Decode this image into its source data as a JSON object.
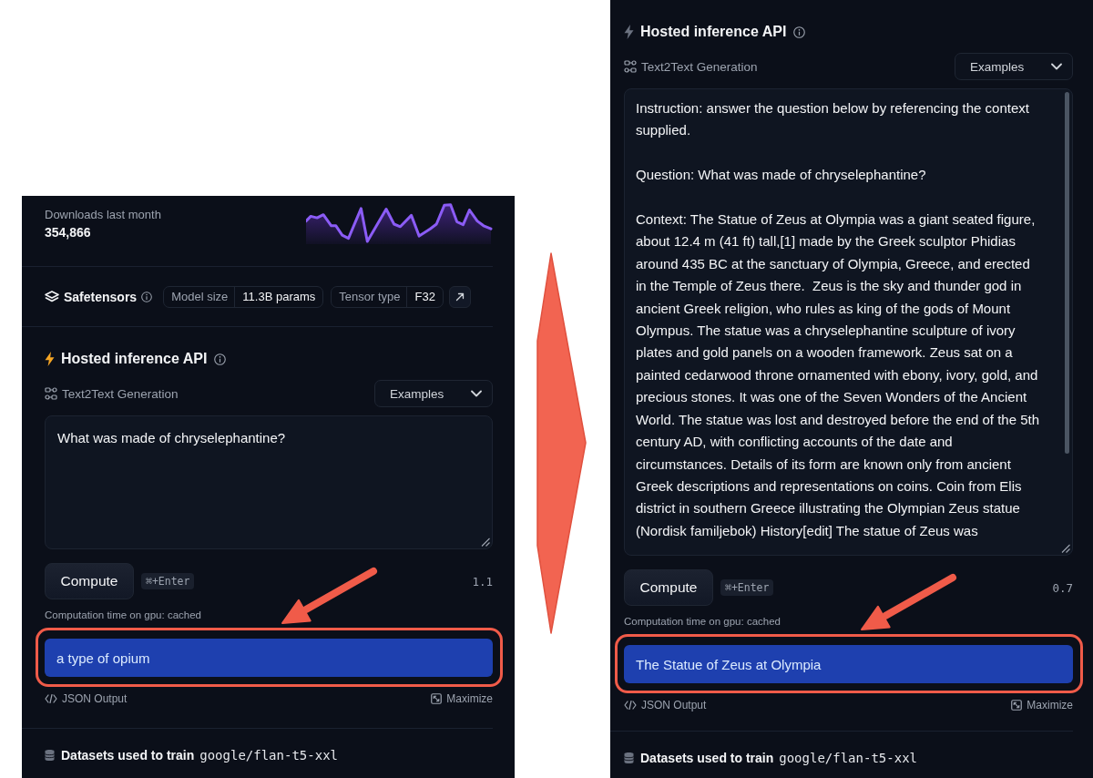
{
  "panels": [
    {
      "downloads": {
        "label": "Downloads last month",
        "value": "354,866"
      },
      "safetensors": {
        "title": "Safetensors",
        "chips": [
          {
            "label": "Model size",
            "value": "11.3B params"
          },
          {
            "label": "Tensor type",
            "value": "F32"
          }
        ]
      },
      "inference": {
        "title": "Hosted inference API",
        "title_icon": {
          "color": "#f5a524"
        },
        "task": "Text2Text Generation",
        "examples_button": "Examples",
        "input": {
          "value": "What was made of chryselephantine?",
          "scrollable": false
        },
        "compute_button": "Compute",
        "shortcut": "⌘+Enter",
        "number": "1.1",
        "computation_note": "Computation time on gpu: cached",
        "output": "a type of opium",
        "output_annotated": true,
        "json_output_link": "JSON Output",
        "maximize_button": "Maximize"
      },
      "datasets": {
        "label": "Datasets used to train",
        "name": "google/flan-t5-xxl"
      }
    },
    {
      "inference": {
        "title": "Hosted inference API",
        "title_icon": {
          "color": "#6b7280"
        },
        "task": "Text2Text Generation",
        "examples_button": "Examples",
        "input": {
          "value": "Instruction: answer the question below by referencing the context supplied.\n\nQuestion: What was made of chryselephantine?\n\nContext: The Statue of Zeus at Olympia was a giant seated figure, about 12.4 m (41 ft) tall,[1] made by the Greek sculptor Phidias around 435 BC at the sanctuary of Olympia, Greece, and erected in the Temple of Zeus there.  Zeus is the sky and thunder god in ancient Greek religion, who rules as king of the gods of Mount Olympus. The statue was a chryselephantine sculpture of ivory plates and gold panels on a wooden framework. Zeus sat on a painted cedarwood throne ornamented with ebony, ivory, gold, and precious stones. It was one of the Seven Wonders of the Ancient World. The statue was lost and destroyed before the end of the 5th century AD, with conflicting accounts of the date and circumstances. Details of its form are known only from ancient Greek descriptions and representations on coins. Coin from Elis district in southern Greece illustrating the Olympian Zeus statue (Nordisk familjebok) History[edit] The statue of Zeus was",
          "scrollable": true
        },
        "compute_button": "Compute",
        "shortcut": "⌘+Enter",
        "number": "0.7",
        "computation_note": "Computation time on gpu: cached",
        "output": "The Statue of Zeus at Olympia",
        "output_annotated": true,
        "json_output_link": "JSON Output",
        "maximize_button": "Maximize"
      },
      "datasets": {
        "label": "Datasets used to train",
        "name": "google/flan-t5-xxl"
      }
    }
  ]
}
